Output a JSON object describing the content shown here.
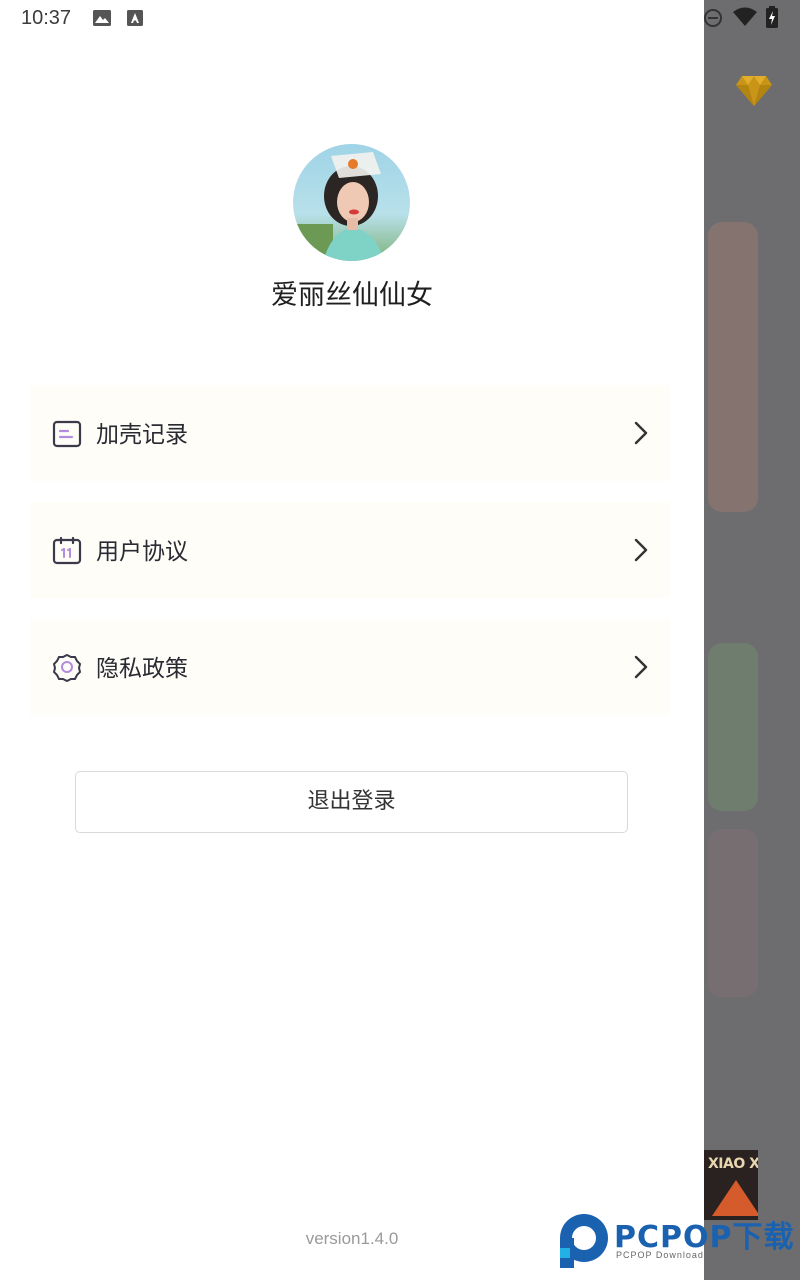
{
  "status_bar": {
    "time": "10:37"
  },
  "profile": {
    "username": "爱丽丝仙仙女"
  },
  "menu": [
    {
      "label": "加壳记录",
      "icon": "list-card-icon"
    },
    {
      "label": "用户协议",
      "icon": "calendar-icon"
    },
    {
      "label": "隐私政策",
      "icon": "badge-icon"
    }
  ],
  "logout_label": "退出登录",
  "version": "version1.4.0",
  "watermark": {
    "brand": "PCPOP下载",
    "sub": "PCPOP Download"
  },
  "background_thumb_text": "XIAO XI",
  "colors": {
    "accent_gold": "#f3b21b",
    "drawer_bg": "#ffffff",
    "menu_bg": "#fefdf8",
    "icon_color": "#3a3a4a"
  }
}
